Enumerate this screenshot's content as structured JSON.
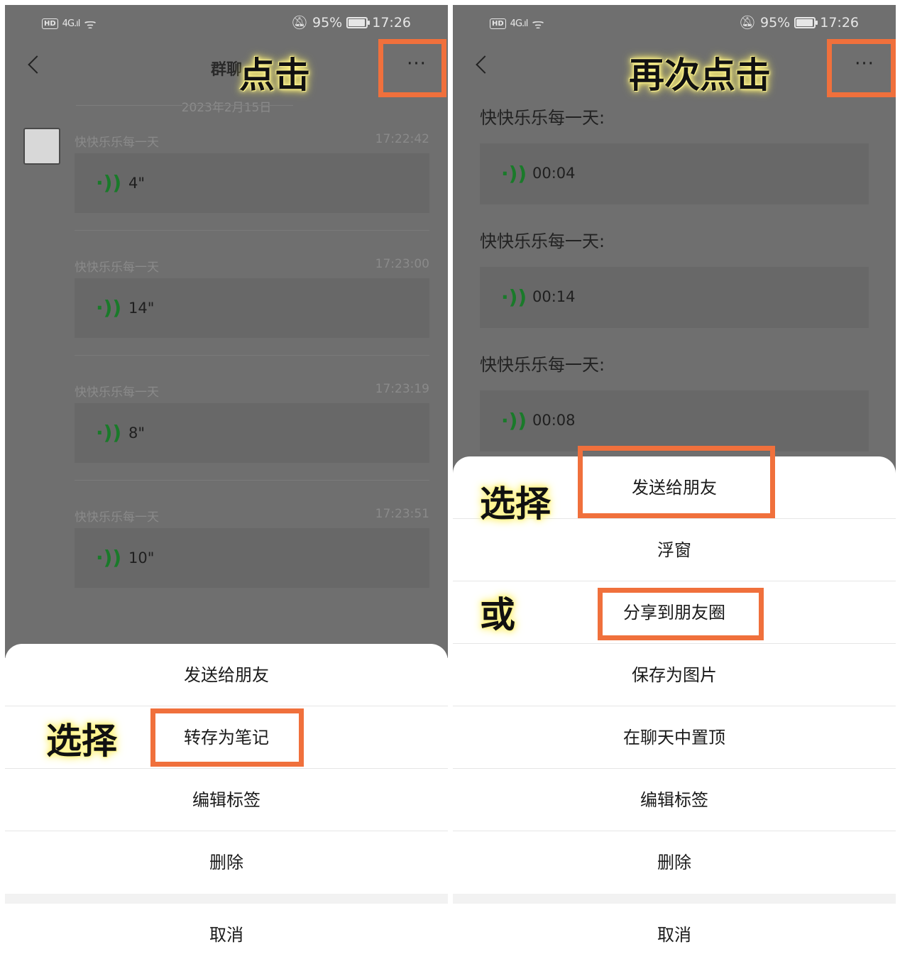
{
  "status": {
    "hd": "HD",
    "network": "4G",
    "battery_pct": "95%",
    "time": "17:26",
    "battery_level": 0.95
  },
  "left": {
    "nav_title": "群聊",
    "more_label": "···",
    "annot_click": "点击",
    "annot_select": "选择",
    "date": "2023年2月15日",
    "messages": [
      {
        "name": "快快乐乐每一天",
        "time": "17:22:42",
        "duration": "4\""
      },
      {
        "name": "快快乐乐每一天",
        "time": "17:23:00",
        "duration": "14\""
      },
      {
        "name": "快快乐乐每一天",
        "time": "17:23:19",
        "duration": "8\""
      },
      {
        "name": "快快乐乐每一天",
        "time": "17:23:51",
        "duration": "10\""
      }
    ],
    "sheet": [
      "发送给朋友",
      "转存为笔记",
      "编辑标签",
      "删除"
    ],
    "cancel": "取消"
  },
  "right": {
    "more_label": "···",
    "annot_click": "再次点击",
    "annot_select": "选择",
    "annot_or": "或",
    "messages": [
      {
        "name": "快快乐乐每一天:",
        "duration": "00:04"
      },
      {
        "name": "快快乐乐每一天:",
        "duration": "00:14"
      },
      {
        "name": "快快乐乐每一天:",
        "duration": "00:08"
      }
    ],
    "sheet": [
      "发送给朋友",
      "浮窗",
      "分享到朋友圈",
      "保存为图片",
      "在聊天中置顶",
      "编辑标签",
      "删除"
    ],
    "cancel": "取消"
  },
  "icons": {
    "back": "chevron-left-icon",
    "more": "ellipsis-icon",
    "voice": "voice-wave-icon",
    "mute": "bell-off-icon",
    "wifi": "wifi-icon",
    "signal": "signal-icon",
    "battery": "battery-icon"
  },
  "colors": {
    "highlight": "#f0703c",
    "voice": "#1a7a2a",
    "annotation_glow": "#fff176"
  }
}
